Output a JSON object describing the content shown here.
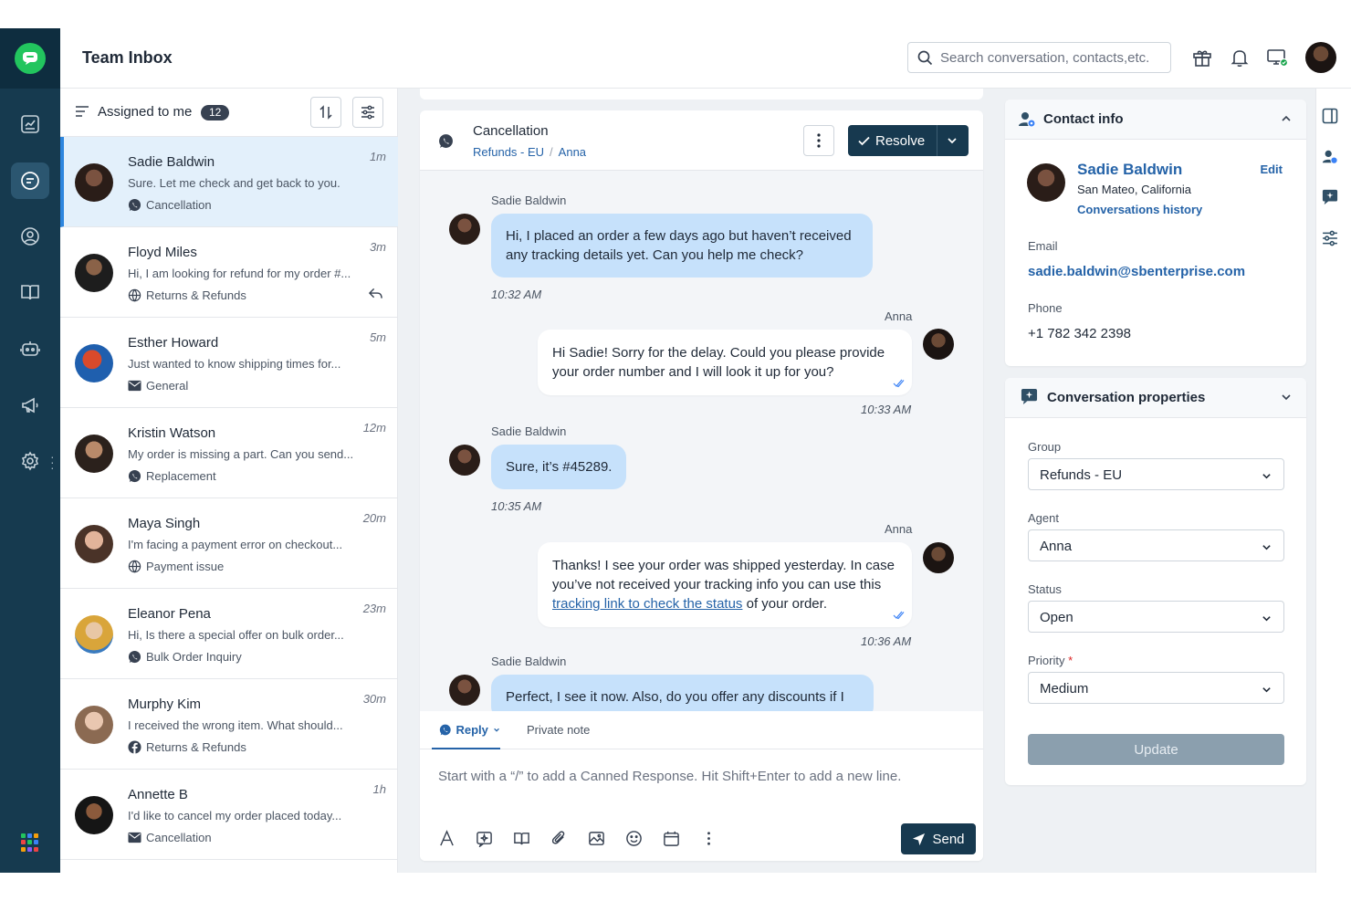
{
  "app": {
    "title": "Team Inbox"
  },
  "header": {
    "search_placeholder": "Search conversation, contacts,etc.",
    "icons": [
      "search-icon",
      "gift-icon",
      "bell-icon",
      "monitor-status-icon",
      "user-avatar"
    ]
  },
  "rail": {
    "items": [
      "dashboard-icon",
      "inbox-icon",
      "contacts-icon",
      "knowledge-base-icon",
      "bot-icon",
      "campaigns-icon",
      "settings-icon"
    ],
    "active": "inbox-icon"
  },
  "list": {
    "filter_label": "Assigned to me",
    "count": "12",
    "conversations": [
      {
        "name": "Sadie Baldwin",
        "time": "1m",
        "preview": "Sure. Let me check and get back to you.",
        "tag": "Cancellation",
        "channel": "whatsapp-icon",
        "active": true
      },
      {
        "name": "Floyd Miles",
        "time": "3m",
        "preview": "Hi, I am looking for refund for my order #...",
        "tag": "Returns & Refunds",
        "channel": "globe-icon",
        "replied": true
      },
      {
        "name": "Esther Howard",
        "time": "5m",
        "preview": "Just wanted to know shipping times for...",
        "tag": "General",
        "channel": "email-icon"
      },
      {
        "name": "Kristin Watson",
        "time": "12m",
        "preview": "My order is missing a part. Can you send...",
        "tag": "Replacement",
        "channel": "whatsapp-icon"
      },
      {
        "name": "Maya Singh",
        "time": "20m",
        "preview": "I'm facing a payment error on checkout...",
        "tag": "Payment issue",
        "channel": "globe-icon"
      },
      {
        "name": "Eleanor Pena",
        "time": "23m",
        "preview": "Hi, Is there a special offer on bulk order...",
        "tag": "Bulk Order Inquiry",
        "channel": "whatsapp-icon"
      },
      {
        "name": "Murphy Kim",
        "time": "30m",
        "preview": "I received the wrong item. What should...",
        "tag": "Returns & Refunds",
        "channel": "facebook-icon"
      },
      {
        "name": "Annette B",
        "time": "1h",
        "preview": "I'd like to cancel my order placed today...",
        "tag": "Cancellation",
        "channel": "email-icon"
      }
    ]
  },
  "chat": {
    "title": "Cancellation",
    "group": "Refunds - EU",
    "agent": "Anna",
    "resolve_label": "Resolve",
    "messages": [
      {
        "from": "Sadie Baldwin",
        "dir": "in",
        "text": "Hi, I placed an order a few days ago but haven’t received any tracking details yet. Can you help me check?",
        "time": "10:32 AM"
      },
      {
        "from": "Anna",
        "dir": "out",
        "text": "Hi Sadie! Sorry for the delay. Could you please provide your order number and I will look it up for you?",
        "time": "10:33 AM"
      },
      {
        "from": "Sadie Baldwin",
        "dir": "in",
        "text": "Sure, it’s #45289.",
        "time": "10:35 AM"
      },
      {
        "from": "Anna",
        "dir": "out",
        "text_before": "Thanks! I see your order was shipped yesterday. In case you’ve not received your tracking info you can use this ",
        "link": "tracking link to check the status",
        "text_after": " of your order.",
        "time": "10:36 AM"
      },
      {
        "from": "Sadie Baldwin",
        "dir": "in",
        "text": "Perfect, I see it now. Also, do you offer any discounts if I"
      }
    ],
    "composer": {
      "tab_reply": "Reply",
      "tab_note": "Private note",
      "placeholder": "Start with a “/” to add a Canned Response. Hit Shift+Enter to add a new line.",
      "send_label": "Send",
      "tools": [
        "text-format-icon",
        "canned-response-icon",
        "knowledge-base-icon",
        "attachment-icon",
        "image-icon",
        "emoji-icon",
        "calendar-icon",
        "more-icon"
      ]
    }
  },
  "contact": {
    "heading": "Contact info",
    "name": "Sadie Baldwin",
    "edit_label": "Edit",
    "location": "San Mateo, California",
    "history_label": "Conversations history",
    "email_label": "Email",
    "email": "sadie.baldwin@sbenterprise.com",
    "phone_label": "Phone",
    "phone": "+1 782 342 2398"
  },
  "properties": {
    "heading": "Conversation properties",
    "group_label": "Group",
    "group_value": "Refunds - EU",
    "agent_label": "Agent",
    "agent_value": "Anna",
    "status_label": "Status",
    "status_value": "Open",
    "priority_label": "Priority",
    "priority_required": "*",
    "priority_value": "Medium",
    "update_label": "Update"
  },
  "colors": {
    "rail": "#163a4f",
    "primary": "#17394f",
    "link": "#2563a8",
    "incoming_bubble": "#c6e1fb",
    "active_row": "#e3f0fb"
  }
}
